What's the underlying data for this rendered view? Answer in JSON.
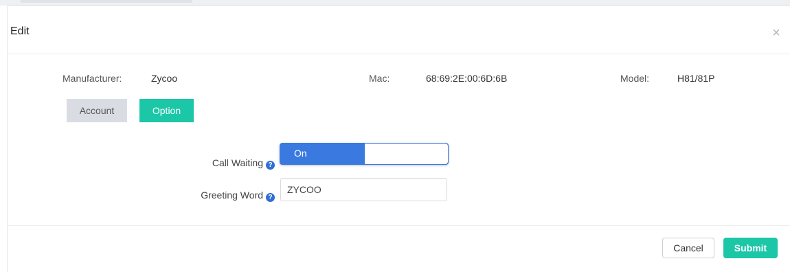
{
  "modal": {
    "title": "Edit",
    "close_icon": "close-icon",
    "close_glyph": "×"
  },
  "device_info": {
    "manufacturer_label": "Manufacturer:",
    "manufacturer_value": "Zycoo",
    "mac_label": "Mac:",
    "mac_value": "68:69:2E:00:6D:6B",
    "model_label": "Model:",
    "model_value": "H81/81P"
  },
  "tabs": [
    {
      "label": "Account",
      "active": false
    },
    {
      "label": "Option",
      "active": true
    }
  ],
  "form": {
    "call_waiting": {
      "label": "Call Waiting",
      "help_icon": "question-circle-icon",
      "state_label": "On",
      "enabled": true
    },
    "greeting_word": {
      "label": "Greeting Word",
      "help_icon": "question-circle-icon",
      "value": "ZYCOO"
    }
  },
  "footer": {
    "cancel_label": "Cancel",
    "submit_label": "Submit"
  },
  "colors": {
    "accent": "#1cc7a8",
    "toggle_on": "#3a7ae0",
    "help_icon": "#2f6fd6",
    "inactive_tab": "#d9dde3"
  }
}
